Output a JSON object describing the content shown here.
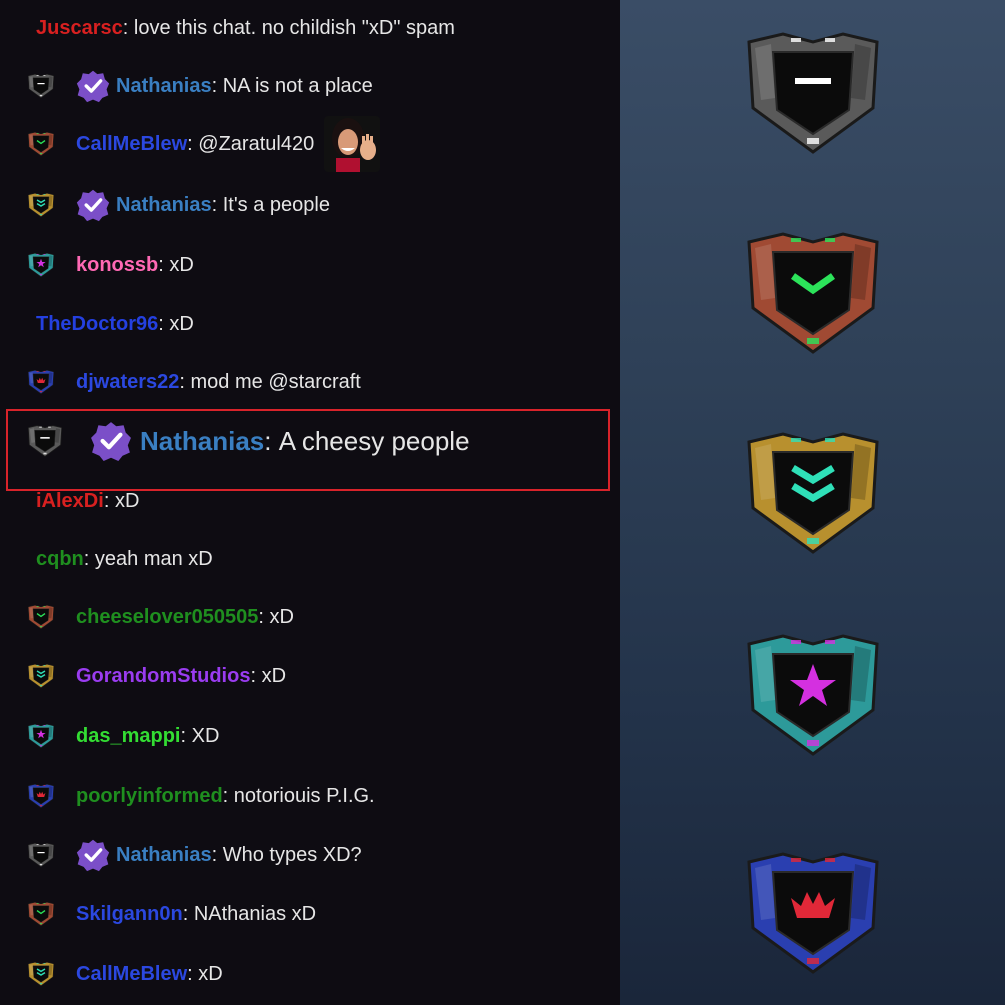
{
  "chat": {
    "messages": [
      {
        "user": "Juscarsc",
        "color": "#d82020",
        "text": "love this chat. no childish \"xD\" spam",
        "rank": null,
        "verified": false,
        "emote": false,
        "highlight": false
      },
      {
        "user": "Nathanias",
        "color": "#3a7fc2",
        "text": "NA is not a place",
        "rank": "bronze-rank-icon",
        "verified": true,
        "emote": false,
        "highlight": false
      },
      {
        "user": "CallMeBlew",
        "color": "#2b48e0",
        "text": "@Zaratul420",
        "rank": "silver-rank-icon",
        "verified": false,
        "emote": true,
        "highlight": false
      },
      {
        "user": "Nathanias",
        "color": "#3a7fc2",
        "text": "It's a people",
        "rank": "gold-rank-icon",
        "verified": true,
        "emote": false,
        "highlight": false
      },
      {
        "user": "konossb",
        "color": "#ff69b4",
        "text": "xD",
        "rank": "platinum-rank-icon",
        "verified": false,
        "emote": false,
        "highlight": false
      },
      {
        "user": "TheDoctor96",
        "color": "#2440e0",
        "text": "xD",
        "rank": null,
        "verified": false,
        "emote": false,
        "highlight": false
      },
      {
        "user": "djwaters22",
        "color": "#2b48e0",
        "text": "mod me @starcraft",
        "rank": "diamond-rank-icon",
        "verified": false,
        "emote": false,
        "highlight": false
      },
      {
        "user": "Nathanias",
        "color": "#3a7fc2",
        "text": "A cheesy people",
        "rank": "bronze-rank-icon",
        "verified": true,
        "emote": false,
        "highlight": true
      },
      {
        "user": "iAlexDi",
        "color": "#d82020",
        "text": "xD",
        "rank": null,
        "verified": false,
        "emote": false,
        "highlight": false
      },
      {
        "user": "cqbn",
        "color": "#1f8f1f",
        "text": "yeah man xD",
        "rank": null,
        "verified": false,
        "emote": false,
        "highlight": false
      },
      {
        "user": "cheeselover050505",
        "color": "#1f8f1f",
        "text": "xD",
        "rank": "silver-rank-icon",
        "verified": false,
        "emote": false,
        "highlight": false
      },
      {
        "user": "GorandomStudios",
        "color": "#9a3cf0",
        "text": "xD",
        "rank": "gold-rank-icon",
        "verified": false,
        "emote": false,
        "highlight": false
      },
      {
        "user": "das_mappi",
        "color": "#33dd33",
        "text": "XD",
        "rank": "platinum-rank-icon",
        "verified": false,
        "emote": false,
        "highlight": false
      },
      {
        "user": "poorlyinformed",
        "color": "#1f8f1f",
        "text": "notoriouis P.I.G.",
        "rank": "diamond-rank-icon",
        "verified": false,
        "emote": false,
        "highlight": false
      },
      {
        "user": "Nathanias",
        "color": "#3a7fc2",
        "text": "Who types XD?",
        "rank": "bronze-rank-icon",
        "verified": true,
        "emote": false,
        "highlight": false
      },
      {
        "user": "Skilgann0n",
        "color": "#2b48e0",
        "text": "NAthanias xD",
        "rank": "silver-rank-icon",
        "verified": false,
        "emote": false,
        "highlight": false
      },
      {
        "user": "CallMeBlew",
        "color": "#2b48e0",
        "text": "xD",
        "rank": "gold-rank-icon",
        "verified": false,
        "emote": false,
        "highlight": false
      }
    ]
  },
  "legend": {
    "ranks": [
      {
        "name": "bronze-rank-icon",
        "frame": "#5a5a5a",
        "glyph": "dash",
        "glyph_color": "#ffffff"
      },
      {
        "name": "silver-rank-icon",
        "frame": "#a04a33",
        "glyph": "chevron-1",
        "glyph_color": "#2ce35a"
      },
      {
        "name": "gold-rank-icon",
        "frame": "#b8902e",
        "glyph": "chevron-2",
        "glyph_color": "#2fe0b8"
      },
      {
        "name": "platinum-rank-icon",
        "frame": "#2d9a9a",
        "glyph": "star",
        "glyph_color": "#d430e0"
      },
      {
        "name": "diamond-rank-icon",
        "frame": "#2a3fb0",
        "glyph": "crown",
        "glyph_color": "#e02838"
      }
    ]
  },
  "colors": {
    "chat_bg": "#0e0c12",
    "text": "#e6e6e6",
    "highlight_border": "#d8232a",
    "verified_badge": "#7b4fc8"
  }
}
